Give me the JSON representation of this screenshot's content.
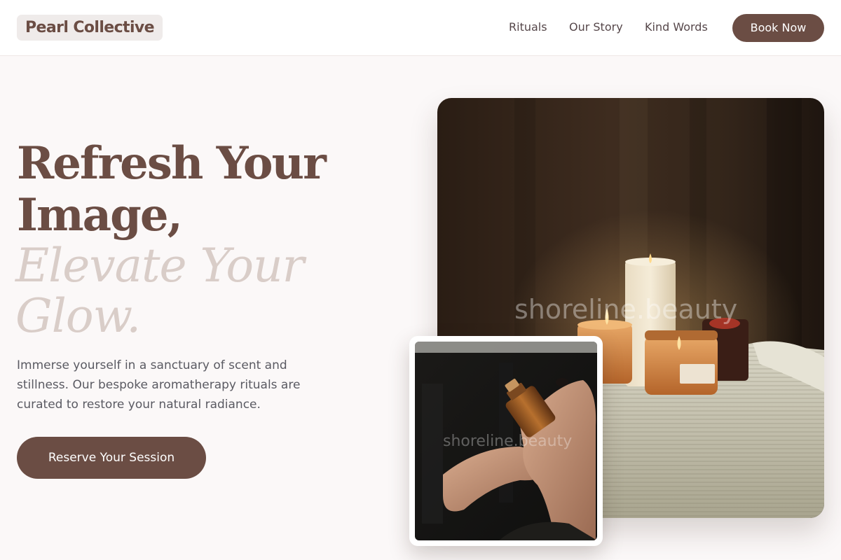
{
  "brand": {
    "name": "Pearl Collective"
  },
  "nav": {
    "links": [
      "Rituals",
      "Our Story",
      "Kind Words"
    ],
    "cta": "Book Now"
  },
  "hero": {
    "title_line1": "Refresh Your",
    "title_line2": "Image,",
    "title_italic_line1": "Elevate Your",
    "title_italic_line2": "Glow.",
    "description": "Immerse yourself in a sanctuary of scent and stillness. Our bespoke aromatherapy rituals are curated to restore your natural radiance.",
    "cta": "Reserve Your Session"
  },
  "images": {
    "main_watermark": "shoreline.beauty",
    "secondary_watermark": "shoreline.beauty"
  },
  "colors": {
    "accent": "#6b4d44",
    "accent_light": "#d9cdc8",
    "background": "#fbf8f8",
    "brand_badge_bg": "#efebea"
  }
}
